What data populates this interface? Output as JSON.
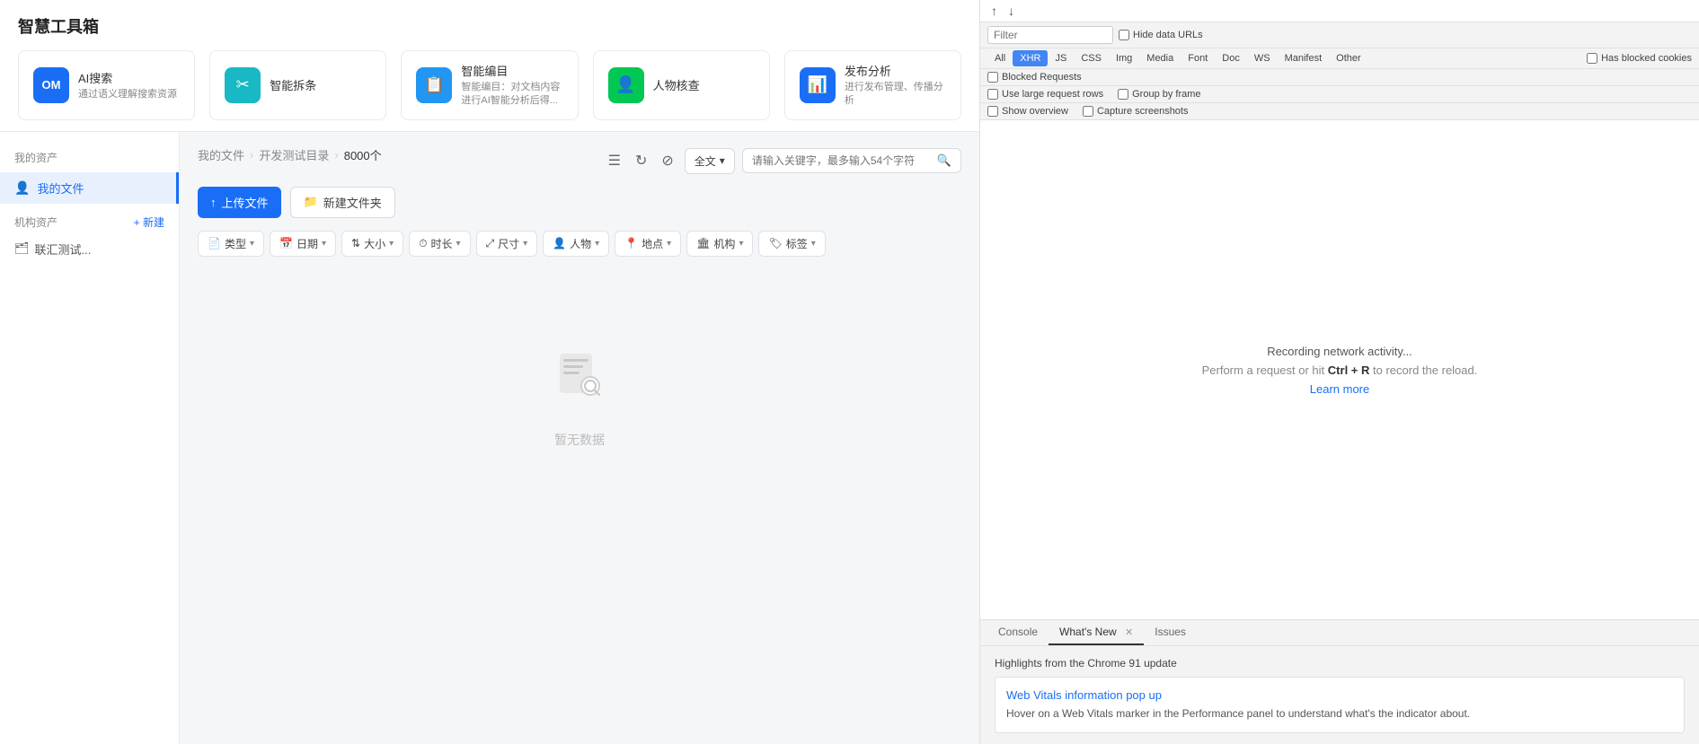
{
  "app": {
    "title": "智慧工具箱"
  },
  "tools": [
    {
      "name": "AI搜索",
      "desc": "通过语义理解搜索资源",
      "icon": "🔍",
      "icon_color": "blue",
      "icon_text": "OM"
    },
    {
      "name": "智能拆条",
      "desc": "",
      "icon": "✂️",
      "icon_color": "teal"
    },
    {
      "name": "智能编目",
      "desc": "智能编目：对文档内容进行AI智能分析后得...",
      "icon": "📋",
      "icon_color": "green-blue"
    },
    {
      "name": "人物核查",
      "desc": "",
      "icon": "👤",
      "icon_color": "green"
    },
    {
      "name": "发布分析",
      "desc": "进行发布管理、传播分析",
      "icon": "📊",
      "icon_color": "blue2"
    }
  ],
  "sidebar": {
    "my_assets_label": "我的资产",
    "my_files_label": "我的文件",
    "org_assets_label": "机构资产",
    "new_label": "+ 新建",
    "org_item_label": "联汇测试..."
  },
  "breadcrumb": {
    "root": "我的文件",
    "sep1": ">",
    "folder": "开发测试目录",
    "sep2": ">",
    "count": "8000个"
  },
  "toolbar": {
    "upload_label": "上传文件",
    "new_folder_label": "新建文件夹",
    "full_text_label": "全文",
    "search_placeholder": "请输入关键字，最多输入54个字符"
  },
  "filters": [
    {
      "label": "类型"
    },
    {
      "label": "日期"
    },
    {
      "label": "大小"
    },
    {
      "label": "时长"
    },
    {
      "label": "尺寸"
    },
    {
      "label": "人物"
    },
    {
      "label": "地点"
    },
    {
      "label": "机构"
    },
    {
      "label": "标签"
    }
  ],
  "empty_state": {
    "text": "暂无数据"
  },
  "devtools": {
    "filter_placeholder": "Filter",
    "hide_data_urls_label": "Hide data URLs",
    "blocked_requests_label": "Blocked Requests",
    "use_large_rows_label": "Use large request rows",
    "show_overview_label": "Show overview",
    "group_by_frame_label": "Group by frame",
    "capture_screenshots_label": "Capture screenshots",
    "type_tabs": [
      "All",
      "XHR",
      "JS",
      "CSS",
      "Img",
      "Media",
      "Font",
      "Doc",
      "WS",
      "Manifest",
      "Other"
    ],
    "active_type_tab": "XHR",
    "has_blocked_cookies_label": "Has blocked cookies",
    "recording_text": "Recording network activity...",
    "perform_text": "Perform a request or hit",
    "ctrl_r": "Ctrl + R",
    "to_record": "to record the reload.",
    "learn_more": "Learn more",
    "bottom_tabs": [
      {
        "label": "Console",
        "closeable": false
      },
      {
        "label": "What's New",
        "closeable": true
      },
      {
        "label": "Issues",
        "closeable": false
      }
    ],
    "active_bottom_tab": "What's New",
    "highlights_title": "Highlights from the Chrome 91 update",
    "whats_new_link": "Web Vitals information pop up",
    "whats_new_desc": "Hover on a Web Vitals marker in the Performance panel to understand what's the indicator about."
  }
}
